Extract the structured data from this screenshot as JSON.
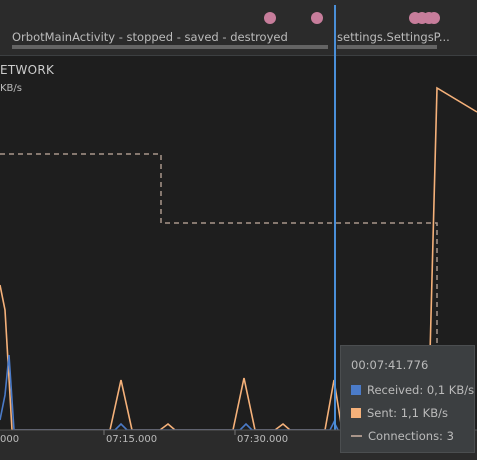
{
  "events": {
    "activity_main": "OrbotMainActivity - stopped - saved - destroyed",
    "activity_settings": "settings.SettingsP...",
    "dot_color": "#c77d9b"
  },
  "network": {
    "title": "ETWORK",
    "unit": "KB/s",
    "colors": {
      "received": "#4b7bc8",
      "sent": "#f5b17a",
      "connections": "#a8958a",
      "cursor": "#4a8fd8"
    }
  },
  "axis": {
    "ticks": [
      "000",
      "07:15.000",
      "07:30.000"
    ]
  },
  "tooltip": {
    "time": "00:07:41.776",
    "received": "Received: 0,1 KB/s",
    "sent": "Sent: 1,1 KB/s",
    "connections": "Connections: 3"
  }
}
